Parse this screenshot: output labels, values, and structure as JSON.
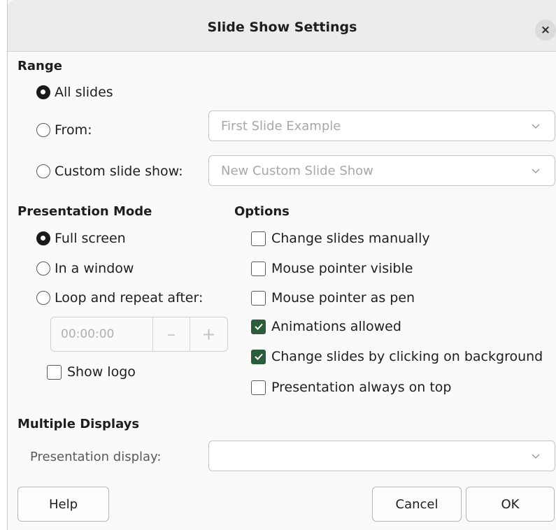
{
  "dialog": {
    "title": "Slide Show Settings",
    "close_glyph": "×"
  },
  "range": {
    "heading": "Range",
    "all_slides_label": "All slides",
    "from_label": "From:",
    "from_value": "First Slide Example",
    "custom_label": "Custom slide show:",
    "custom_value": "New Custom Slide Show",
    "selected": "all_slides"
  },
  "presentation_mode": {
    "heading": "Presentation Mode",
    "full_screen_label": "Full screen",
    "window_label": "In a window",
    "loop_label": "Loop and repeat after:",
    "selected": "full_screen",
    "loop_time": "00:00:00",
    "minus_glyph": "–",
    "plus_glyph": "+",
    "show_logo_label": "Show logo",
    "show_logo_checked": false
  },
  "options": {
    "heading": "Options",
    "items": [
      {
        "label": "Change slides manually",
        "checked": false
      },
      {
        "label": "Mouse pointer visible",
        "checked": false
      },
      {
        "label": "Mouse pointer as pen",
        "checked": false
      },
      {
        "label": "Animations allowed",
        "checked": true
      },
      {
        "label": "Change slides by clicking on background",
        "checked": true
      },
      {
        "label": "Presentation always on top",
        "checked": false
      }
    ]
  },
  "displays": {
    "heading": "Multiple Displays",
    "presentation_display_label": "Presentation display:",
    "presentation_display_value": ""
  },
  "buttons": {
    "help": "Help",
    "cancel": "Cancel",
    "ok": "OK"
  },
  "colors": {
    "check_accent": "#2b5d3a",
    "radio_selected": "#1a1a1a"
  }
}
